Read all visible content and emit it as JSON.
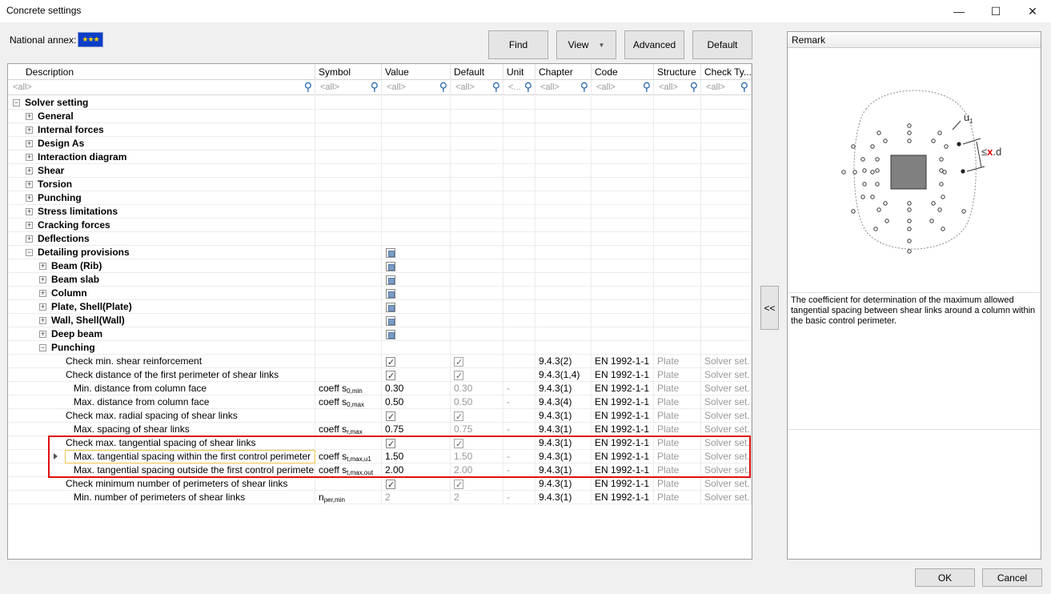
{
  "window": {
    "title": "Concrete settings",
    "minimize": "—",
    "maximize": "☐",
    "close": "✕"
  },
  "national_annex": {
    "label": "National annex:",
    "flag": "eu-flag-icon"
  },
  "toolbar": {
    "find": "Find",
    "view": "View",
    "advanced": "Advanced",
    "default": "Default"
  },
  "columns": [
    "Description",
    "Symbol",
    "Value",
    "Default",
    "Unit",
    "Chapter",
    "Code",
    "Structure",
    "Check Ty..."
  ],
  "filters": [
    "<all>",
    "<all>",
    "<all>",
    "<all>",
    "<...",
    "<all>",
    "<all>",
    "<all>",
    "<all>"
  ],
  "rows": [
    {
      "desc": "Solver setting",
      "bold": true,
      "exp": "⊟",
      "indent": 0
    },
    {
      "desc": "General",
      "bold": true,
      "exp": "⊞",
      "indent": 1
    },
    {
      "desc": "Internal forces",
      "bold": true,
      "exp": "⊞",
      "indent": 1
    },
    {
      "desc": "Design As",
      "bold": true,
      "exp": "⊞",
      "indent": 1
    },
    {
      "desc": "Interaction diagram",
      "bold": true,
      "exp": "⊞",
      "indent": 1
    },
    {
      "desc": "Shear",
      "bold": true,
      "exp": "⊞",
      "indent": 1
    },
    {
      "desc": "Torsion",
      "bold": true,
      "exp": "⊞",
      "indent": 1
    },
    {
      "desc": "Punching",
      "bold": true,
      "exp": "⊞",
      "indent": 1
    },
    {
      "desc": "Stress limitations",
      "bold": true,
      "exp": "⊞",
      "indent": 1
    },
    {
      "desc": "Cracking forces",
      "bold": true,
      "exp": "⊞",
      "indent": 1
    },
    {
      "desc": "Deflections",
      "bold": true,
      "exp": "⊞",
      "indent": 1
    },
    {
      "desc": "Detailing provisions",
      "bold": true,
      "exp": "⊟",
      "indent": 1,
      "value_cb": "ind"
    },
    {
      "desc": "Beam (Rib)",
      "bold": true,
      "exp": "⊞",
      "indent": 2,
      "value_cb": "ind"
    },
    {
      "desc": "Beam slab",
      "bold": true,
      "exp": "⊞",
      "indent": 2,
      "value_cb": "ind"
    },
    {
      "desc": "Column",
      "bold": true,
      "exp": "⊞",
      "indent": 2,
      "value_cb": "ind"
    },
    {
      "desc": "Plate, Shell(Plate)",
      "bold": true,
      "exp": "⊞",
      "indent": 2,
      "value_cb": "ind"
    },
    {
      "desc": "Wall, Shell(Wall)",
      "bold": true,
      "exp": "⊞",
      "indent": 2,
      "value_cb": "ind"
    },
    {
      "desc": "Deep beam",
      "bold": true,
      "exp": "⊞",
      "indent": 2,
      "value_cb": "ind"
    },
    {
      "desc": "Punching",
      "bold": true,
      "exp": "⊟",
      "indent": 2
    },
    {
      "desc": "Check min. shear reinforcement",
      "indent": 3,
      "value_cb": "chk",
      "default_cb": "chk",
      "chapter": "9.4.3(2)",
      "code": "EN 1992-1-1",
      "structure": "Plate",
      "check": "Solver set..."
    },
    {
      "desc": "Check distance of the first perimeter of shear links",
      "indent": 3,
      "value_cb": "chk",
      "default_cb": "chk",
      "chapter": "9.4.3(1,4)",
      "code": "EN 1992-1-1",
      "structure": "Plate",
      "check": "Solver set..."
    },
    {
      "desc": "Min. distance from column face",
      "indent": 4,
      "symbol": "coeff s",
      "sub": "0,min",
      "value": "0.30",
      "default": "0.30",
      "unit": "-",
      "chapter": "9.4.3(1)",
      "code": "EN 1992-1-1",
      "structure": "Plate",
      "check": "Solver set..."
    },
    {
      "desc": "Max. distance from column face",
      "indent": 4,
      "symbol": "coeff s",
      "sub": "0,max",
      "value": "0.50",
      "default": "0.50",
      "unit": "-",
      "chapter": "9.4.3(4)",
      "code": "EN 1992-1-1",
      "structure": "Plate",
      "check": "Solver set..."
    },
    {
      "desc": "Check max. radial spacing of shear links",
      "indent": 3,
      "value_cb": "chk",
      "default_cb": "chk",
      "chapter": "9.4.3(1)",
      "code": "EN 1992-1-1",
      "structure": "Plate",
      "check": "Solver set..."
    },
    {
      "desc": "Max. spacing of shear links",
      "indent": 4,
      "symbol": "coeff s",
      "sub": "r,max",
      "value": "0.75",
      "default": "0.75",
      "unit": "-",
      "chapter": "9.4.3(1)",
      "code": "EN 1992-1-1",
      "structure": "Plate",
      "check": "Solver set..."
    },
    {
      "desc": "Check max. tangential spacing of shear links",
      "indent": 3,
      "value_cb": "chk",
      "default_cb": "chk",
      "chapter": "9.4.3(1)",
      "code": "EN 1992-1-1",
      "structure": "Plate",
      "check": "Solver set..."
    },
    {
      "desc": "Max. tangential spacing within the first control perimeter",
      "indent": 4,
      "symbol": "coeff s",
      "sub": "t,max,u1",
      "value": "1.50",
      "default": "1.50",
      "unit": "-",
      "chapter": "9.4.3(1)",
      "code": "EN 1992-1-1",
      "structure": "Plate",
      "check": "Solver set..."
    },
    {
      "desc": "Max. tangential spacing outside the first control perimeter",
      "indent": 4,
      "symbol": "coeff s",
      "sub": "t,max,out",
      "value": "2.00",
      "default": "2.00",
      "unit": "-",
      "chapter": "9.4.3(1)",
      "code": "EN 1992-1-1",
      "structure": "Plate",
      "check": "Solver set..."
    },
    {
      "desc": "Check minimum number of perimeters of shear links",
      "indent": 3,
      "value_cb": "chk",
      "default_cb": "chk",
      "chapter": "9.4.3(1)",
      "code": "EN 1992-1-1",
      "structure": "Plate",
      "check": "Solver set..."
    },
    {
      "desc": "Min. number of perimeters of shear links",
      "indent": 4,
      "symbol": "n",
      "sub": "per,min",
      "value": "2",
      "value_gray": true,
      "default": "2",
      "unit": "-",
      "chapter": "9.4.3(1)",
      "code": "EN 1992-1-1",
      "structure": "Plate",
      "check": "Solver set..."
    }
  ],
  "collapse_label": "<<",
  "remark": {
    "header": "Remark",
    "text": "The coefficient for determination of the maximum allowed tangential spacing between shear links around a column within the basic control perimeter.",
    "fig_u": "u",
    "fig_u_sub": "1",
    "fig_le": "≤",
    "fig_x": "x",
    "fig_d": ".d"
  },
  "footer": {
    "ok": "OK",
    "cancel": "Cancel"
  }
}
